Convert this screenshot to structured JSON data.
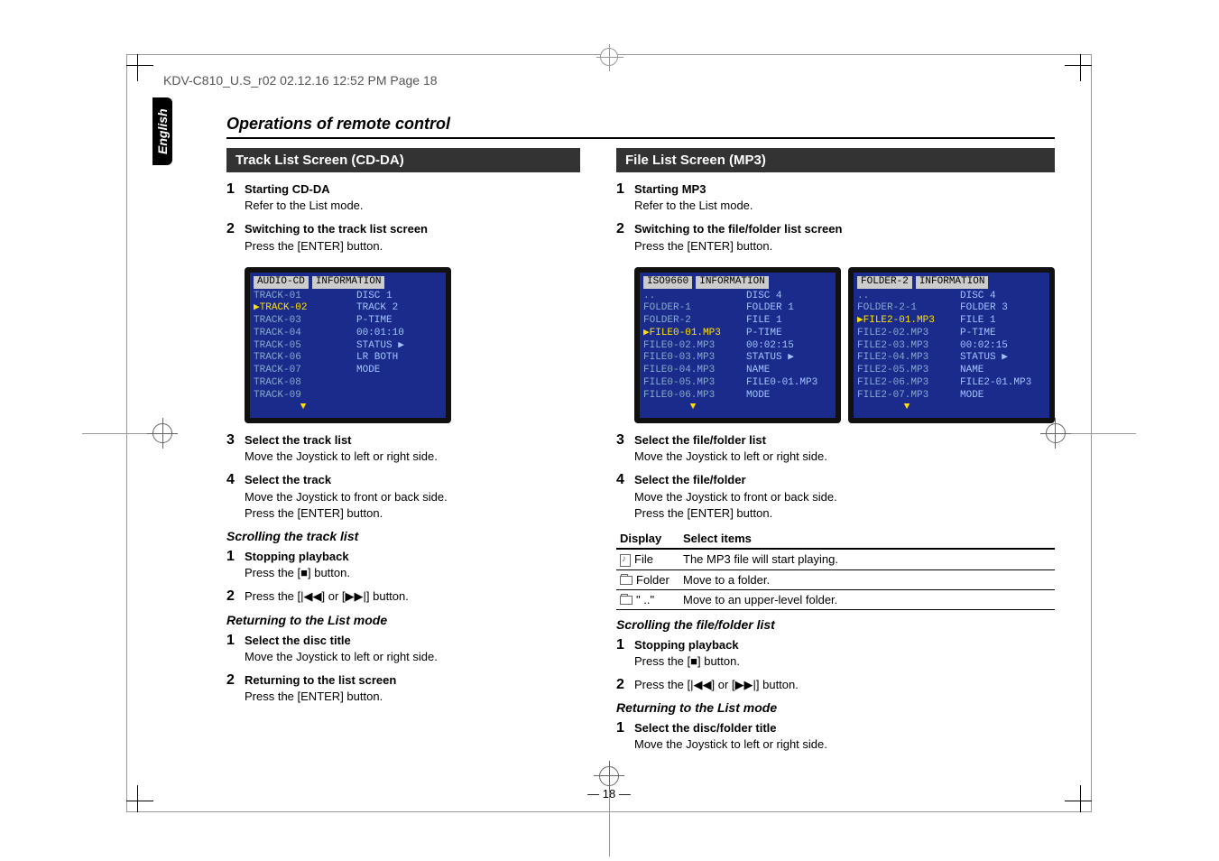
{
  "header_line": "KDV-C810_U.S_r02  02.12.16  12:52 PM  Page 18",
  "lang_tab": "English",
  "section_title": "Operations of remote control",
  "page_number": "— 18 —",
  "left": {
    "heading": "Track List Screen (CD-DA)",
    "steps": [
      {
        "n": "1",
        "bold": "Starting CD-DA",
        "text": "Refer to the List mode."
      },
      {
        "n": "2",
        "bold": "Switching to the track list screen",
        "text": "Press the [ENTER] button."
      }
    ],
    "osd": {
      "title": "AUDIO-CD",
      "info_label": "INFORMATION",
      "list": [
        "TRACK-01",
        "TRACK-02",
        "TRACK-03",
        "TRACK-04",
        "TRACK-05",
        "TRACK-06",
        "TRACK-07",
        "TRACK-08",
        "TRACK-09"
      ],
      "current_index": 1,
      "info": [
        "DISC           1",
        "TRACK          2",
        "",
        "P-TIME",
        "     00:01:10",
        "STATUS   ▶",
        "      LR BOTH",
        "",
        "MODE"
      ]
    },
    "steps2": [
      {
        "n": "3",
        "bold": "Select the track list",
        "text": "Move the Joystick to left or right side."
      },
      {
        "n": "4",
        "bold": "Select the track",
        "text": "Move the Joystick to front or back side.\nPress the [ENTER] button."
      }
    ],
    "sub1": "Scrolling the track list",
    "scroll_steps": [
      {
        "n": "1",
        "bold": "Stopping playback",
        "text": "Press the [■] button."
      },
      {
        "n": "2",
        "bold": "",
        "text": "Press the [|◀◀] or [▶▶|] button."
      }
    ],
    "sub2": "Returning to the List mode",
    "return_steps": [
      {
        "n": "1",
        "bold": "Select the disc title",
        "text": "Move the Joystick to left or right side."
      },
      {
        "n": "2",
        "bold": "Returning to the list screen",
        "text": "Press the [ENTER] button."
      }
    ]
  },
  "right": {
    "heading": "File List Screen (MP3)",
    "steps": [
      {
        "n": "1",
        "bold": "Starting MP3",
        "text": "Refer to the List mode."
      },
      {
        "n": "2",
        "bold": "Switching to the file/folder list screen",
        "text": "Press the [ENTER] button."
      }
    ],
    "osd1": {
      "title": "ISO9660",
      "info_label": "INFORMATION",
      "list": [
        "..",
        "FOLDER-1",
        "FOLDER-2",
        "FILE0-01.MP3",
        "FILE0-02.MP3",
        "FILE0-03.MP3",
        "FILE0-04.MP3",
        "FILE0-05.MP3",
        "FILE0-06.MP3"
      ],
      "current_index": 3,
      "info": [
        "DISC          4",
        "FOLDER        1",
        "FILE          1",
        "P-TIME",
        "     00:02:15",
        "STATUS   ▶",
        "NAME",
        "FILE0-01.MP3",
        "MODE"
      ]
    },
    "osd2": {
      "title": "FOLDER-2",
      "info_label": "INFORMATION",
      "list": [
        "..",
        "FOLDER-2-1",
        "FILE2-01.MP3",
        "FILE2-02.MP3",
        "FILE2-03.MP3",
        "FILE2-04.MP3",
        "FILE2-05.MP3",
        "FILE2-06.MP3",
        "FILE2-07.MP3"
      ],
      "current_index": 2,
      "info": [
        "DISC          4",
        "FOLDER        3",
        "FILE          1",
        "P-TIME",
        "     00:02:15",
        "STATUS   ▶",
        "NAME",
        "FILE2-01.MP3",
        "MODE"
      ]
    },
    "steps2": [
      {
        "n": "3",
        "bold": "Select the file/folder list",
        "text": "Move the Joystick to left or right side."
      },
      {
        "n": "4",
        "bold": "Select the file/folder",
        "text": "Move the Joystick to front or back side.\nPress the [ENTER] button."
      }
    ],
    "table": {
      "head": [
        "Display",
        "Select items"
      ],
      "rows": [
        {
          "icon": "file",
          "label": "File",
          "desc": "The MP3 file will start playing."
        },
        {
          "icon": "folder",
          "label": "Folder",
          "desc": "Move to a folder."
        },
        {
          "icon": "folder",
          "label": "\"    ..\"",
          "desc": "Move to an upper-level folder."
        }
      ]
    },
    "sub1": "Scrolling the file/folder list",
    "scroll_steps": [
      {
        "n": "1",
        "bold": "Stopping playback",
        "text": "Press the [■] button."
      },
      {
        "n": "2",
        "bold": "",
        "text": "Press the [|◀◀] or [▶▶|] button."
      }
    ],
    "sub2": "Returning to the List mode",
    "return_steps": [
      {
        "n": "1",
        "bold": "Select the disc/folder title",
        "text": "Move the Joystick to left or right side."
      }
    ]
  }
}
